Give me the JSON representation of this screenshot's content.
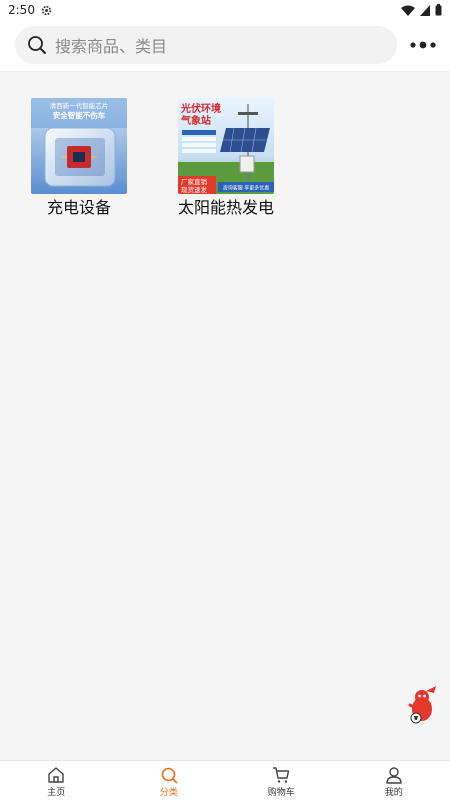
{
  "status_bar": {
    "time": "2:50"
  },
  "search": {
    "placeholder": "搜索商品、类目"
  },
  "categories": [
    {
      "label": "充电设备",
      "image": "charger-chip-thumbnail",
      "image_text": [
        "清西新一代智能芯片",
        "安全智能不伤车"
      ]
    },
    {
      "label": "太阳能热发电",
      "image": "solar-weather-station-thumbnail",
      "image_text": [
        "光伏环境",
        "气象站",
        "厂家直销",
        "现货速发",
        "咨询客服 享更多优惠"
      ]
    }
  ],
  "tabbar": {
    "items": [
      {
        "label": "主页",
        "icon": "home-icon",
        "active": false
      },
      {
        "label": "分类",
        "icon": "search-icon",
        "active": true
      },
      {
        "label": "购物车",
        "icon": "cart-icon",
        "active": false
      },
      {
        "label": "我的",
        "icon": "user-icon",
        "active": false
      }
    ]
  },
  "colors": {
    "accent": "#ef6b1c",
    "background": "#f5f5f5"
  }
}
